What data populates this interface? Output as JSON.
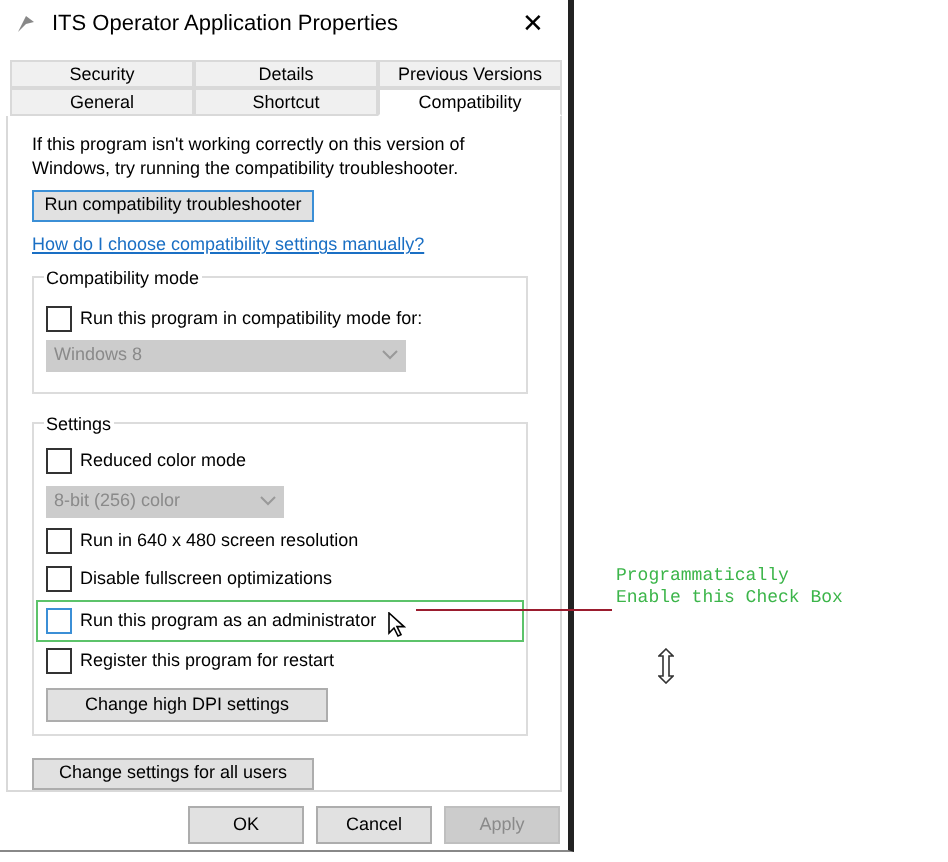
{
  "window": {
    "title": "ITS Operator Application Properties",
    "close": "✕"
  },
  "tab_rows": [
    [
      {
        "label": "Security",
        "selected": false
      },
      {
        "label": "Details",
        "selected": false
      },
      {
        "label": "Previous Versions",
        "selected": false
      }
    ],
    [
      {
        "label": "General",
        "selected": false
      },
      {
        "label": "Shortcut",
        "selected": false
      },
      {
        "label": "Compatibility",
        "selected": true
      }
    ]
  ],
  "intro": "If this program isn't working correctly on this version of Windows, try running the compatibility troubleshooter.",
  "troubleshooter_button": "Run compatibility troubleshooter",
  "help_link": "How do I choose compatibility settings manually?",
  "compatibility_mode": {
    "title": "Compatibility mode",
    "checkbox": {
      "label": "Run this program in compatibility mode for:",
      "checked": false
    },
    "dropdown": {
      "value": "Windows 8",
      "disabled": true
    }
  },
  "settings": {
    "title": "Settings",
    "items": [
      {
        "kind": "checkbox",
        "label": "Reduced color mode",
        "checked": false,
        "highlighted": false
      },
      {
        "kind": "dropdown",
        "value": "8-bit (256) color",
        "disabled": true
      },
      {
        "kind": "checkbox",
        "label": "Run in 640 x 480 screen resolution",
        "checked": false,
        "highlighted": false
      },
      {
        "kind": "checkbox",
        "label": "Disable fullscreen optimizations",
        "checked": false,
        "highlighted": false
      },
      {
        "kind": "checkbox",
        "label": "Run this program as an administrator",
        "checked": false,
        "highlighted": true
      },
      {
        "kind": "checkbox",
        "label": "Register this program for restart",
        "checked": false,
        "highlighted": false
      },
      {
        "kind": "button",
        "label": "Change high DPI settings"
      }
    ]
  },
  "all_users_button": "Change settings for all users",
  "buttons": [
    {
      "label": "OK",
      "disabled": false
    },
    {
      "label": "Cancel",
      "disabled": false
    },
    {
      "label": "Apply",
      "disabled": true
    }
  ],
  "annotation": "Programmatically\nEnable this Check Box"
}
